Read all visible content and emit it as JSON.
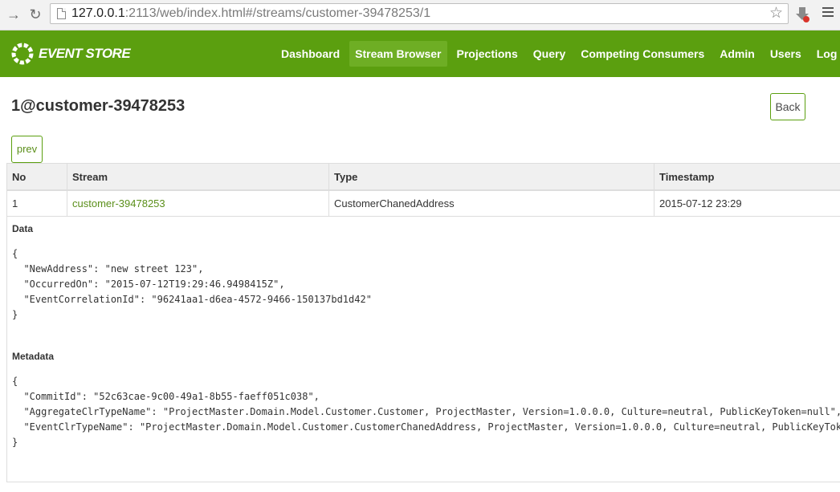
{
  "browser": {
    "url_host": "127.0.0.1",
    "url_rest": ":2113/web/index.html#/streams/customer-39478253/1"
  },
  "navbar": {
    "brand": "EVENT STORE",
    "items": [
      {
        "label": "Dashboard"
      },
      {
        "label": "Stream Browser",
        "active": true
      },
      {
        "label": "Projections"
      },
      {
        "label": "Query"
      },
      {
        "label": "Competing Consumers"
      },
      {
        "label": "Admin"
      },
      {
        "label": "Users"
      },
      {
        "label": "Log Out"
      }
    ]
  },
  "page": {
    "title": "1@customer-39478253",
    "back_label": "Back",
    "prev_label": "prev"
  },
  "table": {
    "headers": {
      "no": "No",
      "stream": "Stream",
      "type": "Type",
      "timestamp": "Timestamp"
    },
    "row": {
      "no": "1",
      "stream": "customer-39478253",
      "type": "CustomerChanedAddress",
      "timestamp": "2015-07-12 23:29"
    }
  },
  "event": {
    "data_label": "Data",
    "data_json": "{\n  \"NewAddress\": \"new street 123\",\n  \"OccurredOn\": \"2015-07-12T19:29:46.9498415Z\",\n  \"EventCorrelationId\": \"96241aa1-d6ea-4572-9466-150137bd1d42\"\n}",
    "metadata_label": "Metadata",
    "metadata_json": "{\n  \"CommitId\": \"52c63cae-9c00-49a1-8b55-faeff051c038\",\n  \"AggregateClrTypeName\": \"ProjectMaster.Domain.Model.Customer.Customer, ProjectMaster, Version=1.0.0.0, Culture=neutral, PublicKeyToken=null\",\n  \"EventClrTypeName\": \"ProjectMaster.Domain.Model.Customer.CustomerChanedAddress, ProjectMaster, Version=1.0.0.0, Culture=neutral, PublicKeyToken=null\"\n}"
  },
  "colors": {
    "brand_green": "#5b9f0f",
    "link_green": "#5b8f1a"
  }
}
